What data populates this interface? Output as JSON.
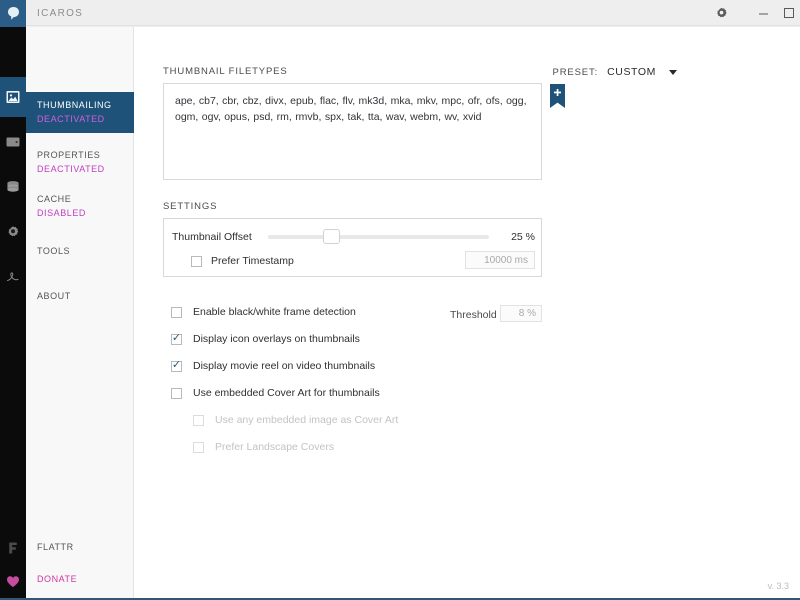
{
  "window": {
    "app_title": "ICAROS",
    "version": "v. 3.3",
    "controls": {
      "settings_icon": "gear-icon",
      "minimize_label": "–",
      "maximize_label": "▫"
    }
  },
  "colors": {
    "accent_blue": "#1f5279",
    "rail_black": "#0b0b0b",
    "magenta": "#c03fc0",
    "donate_pink": "#d0379f",
    "titlebar_gray": "#eeeeee",
    "sidebar_gray": "#f8f8f8"
  },
  "rail": {
    "logo_icon": "icaros-logo-icon",
    "items": [
      {
        "icon": "thumbnail-image-icon",
        "active": true
      },
      {
        "icon": "properties-tag-icon",
        "active": false
      },
      {
        "icon": "cache-database-icon",
        "active": false
      },
      {
        "icon": "tools-gear-icon",
        "active": false
      },
      {
        "icon": "about-signature-icon",
        "active": false
      }
    ],
    "footer_items": [
      {
        "icon": "flattr-icon"
      },
      {
        "icon": "heart-donate-icon"
      }
    ]
  },
  "sidebar": {
    "items": [
      {
        "title": "THUMBNAILING",
        "status": "DEACTIVATED",
        "active": true
      },
      {
        "title": "PROPERTIES",
        "status": "DEACTIVATED",
        "active": false
      },
      {
        "title": "CACHE",
        "status": "DISABLED",
        "active": false
      },
      {
        "title": "TOOLS",
        "status": "",
        "active": false
      },
      {
        "title": "ABOUT",
        "status": "",
        "active": false
      }
    ],
    "footer": [
      {
        "title": "FLATTR"
      },
      {
        "title": "DONATE"
      }
    ]
  },
  "main": {
    "filetypes_label": "THUMBNAIL FILETYPES",
    "preset_label": "PRESET:",
    "preset_value": "CUSTOM",
    "filetypes_value": "ape, cb7, cbr, cbz, divx, epub, flac, flv, mk3d, mka, mkv, mpc, ofr, ofs, ogg, ogm, ogv, opus, psd, rm, rmvb, spx, tak, tta, wav, webm, wv, xvid",
    "add_preset_icon": "bookmark-plus-icon",
    "settings_label": "SETTINGS",
    "thumbnail_offset": {
      "label": "Thumbnail Offset",
      "value": "25 %",
      "percent": 25
    },
    "prefer_timestamp": {
      "label": "Prefer Timestamp",
      "checked": false,
      "field_value": "10000 ms"
    },
    "threshold": {
      "label": "Threshold",
      "value": "8 %"
    },
    "options": [
      {
        "label": "Enable black/white frame detection",
        "checked": false,
        "disabled": false,
        "sub": false
      },
      {
        "label": "Display icon overlays on thumbnails",
        "checked": true,
        "disabled": false,
        "sub": false
      },
      {
        "label": "Display movie reel on video thumbnails",
        "checked": true,
        "disabled": false,
        "sub": false
      },
      {
        "label": "Use embedded Cover Art for thumbnails",
        "checked": false,
        "disabled": false,
        "sub": false
      },
      {
        "label": "Use any embedded image as Cover Art",
        "checked": false,
        "disabled": true,
        "sub": true
      },
      {
        "label": "Prefer Landscape Covers",
        "checked": false,
        "disabled": true,
        "sub": true
      }
    ]
  }
}
